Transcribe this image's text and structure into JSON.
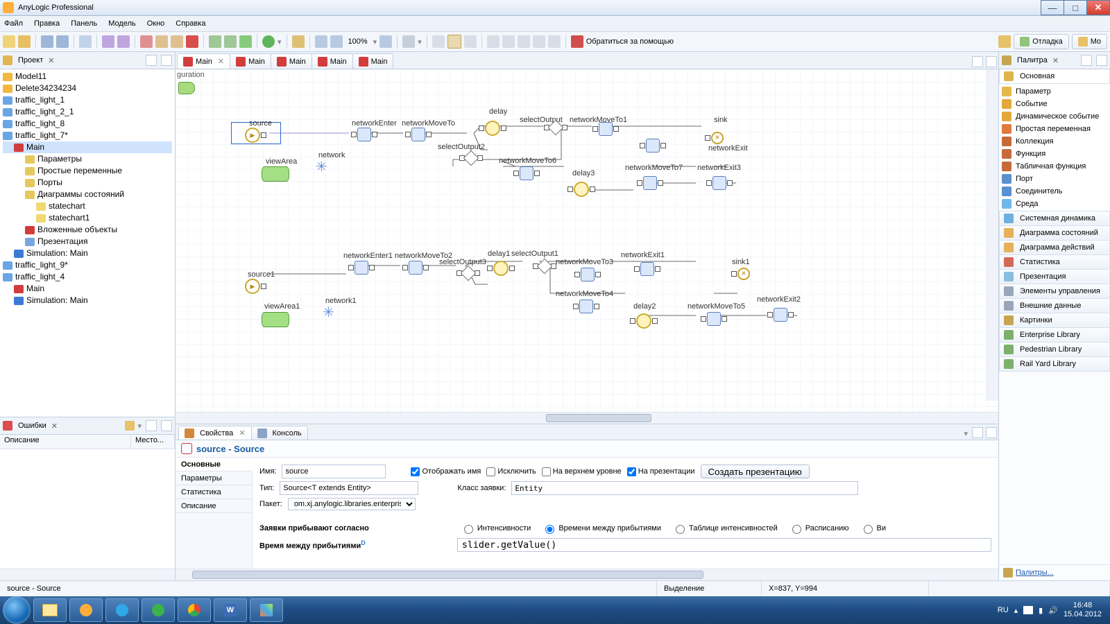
{
  "window": {
    "title": "AnyLogic Professional"
  },
  "menu": [
    "Файл",
    "Правка",
    "Панель",
    "Модель",
    "Окно",
    "Справка"
  ],
  "toolbar": {
    "zoom": "100%",
    "help": "Обратиться за помощью",
    "debug": "Отладка",
    "mo": "Mo"
  },
  "panels": {
    "project": "Проект",
    "errors": "Ошибки",
    "palette": "Палитра"
  },
  "tree": [
    {
      "t": "Model11",
      "ind": 0,
      "c": "#f3b83f"
    },
    {
      "t": "Delete34234234",
      "ind": 0,
      "c": "#f3b83f"
    },
    {
      "t": "traffic_light_1",
      "ind": 0,
      "c": "#6aa5e6"
    },
    {
      "t": "traffic_light_2_1",
      "ind": 0,
      "c": "#6aa5e6"
    },
    {
      "t": "traffic_light_8",
      "ind": 0,
      "c": "#6aa5e6"
    },
    {
      "t": "traffic_light_7*",
      "ind": 0,
      "c": "#6aa5e6"
    },
    {
      "t": "Main",
      "ind": 1,
      "c": "#d23c3c",
      "sel": true
    },
    {
      "t": "Параметры",
      "ind": 2,
      "c": "#e6c85d"
    },
    {
      "t": "Простые переменные",
      "ind": 2,
      "c": "#e6c85d"
    },
    {
      "t": "Порты",
      "ind": 2,
      "c": "#e6c85d"
    },
    {
      "t": "Диаграммы состояний",
      "ind": 2,
      "c": "#e6c85d"
    },
    {
      "t": "statechart",
      "ind": 3,
      "c": "#f0d873"
    },
    {
      "t": "statechart1",
      "ind": 3,
      "c": "#f0d873"
    },
    {
      "t": "Вложенные объекты",
      "ind": 2,
      "c": "#d23c3c"
    },
    {
      "t": "Презентация",
      "ind": 2,
      "c": "#7aa6e0"
    },
    {
      "t": "Simulation: Main",
      "ind": 1,
      "c": "#3a7bd5"
    },
    {
      "t": "traffic_light_9*",
      "ind": 0,
      "c": "#6aa5e6"
    },
    {
      "t": "traffic_light_4",
      "ind": 0,
      "c": "#6aa5e6"
    },
    {
      "t": "Main",
      "ind": 1,
      "c": "#d23c3c"
    },
    {
      "t": "Simulation: Main",
      "ind": 1,
      "c": "#3a7bd5"
    }
  ],
  "err": {
    "col1": "Описание",
    "col2": "Место..."
  },
  "editor": {
    "tabs": [
      "Main",
      "Main",
      "Main",
      "Main",
      "Main"
    ],
    "corner": "guration"
  },
  "nodes": {
    "source": "source",
    "networkEnter": "networkEnter",
    "networkMoveTo": "networkMoveTo",
    "delay": "delay",
    "selectOutput": "selectOutput",
    "networkMoveTo1": "networkMoveTo1",
    "sink": "sink",
    "networkExit": "networkExit",
    "selectOutput2": "selectOutput2",
    "viewArea": "viewArea",
    "network": "network",
    "networkMoveTo6": "networkMoveTo6",
    "delay3": "delay3",
    "networkMoveTo7": "networkMoveTo7",
    "networkExit3": "networkExit3",
    "source1": "source1",
    "networkEnter1": "networkEnter1",
    "networkMoveTo2": "networkMoveTo2",
    "selectOutput3": "selectOutput3",
    "delay1": "delay1",
    "selectOutput1": "selectOutput1",
    "networkMoveTo3": "networkMoveTo3",
    "networkExit1": "networkExit1",
    "sink1": "sink1",
    "viewArea1": "viewArea1",
    "network1": "network1",
    "networkMoveTo4": "networkMoveTo4",
    "delay2": "delay2",
    "networkMoveTo5": "networkMoveTo5",
    "networkExit2": "networkExit2"
  },
  "props": {
    "tabProperties": "Свойства",
    "tabConsole": "Консоль",
    "title": "source - Source",
    "side": [
      "Основные",
      "Параметры",
      "Статистика",
      "Описание"
    ],
    "lblName": "Имя:",
    "valName": "source",
    "cbShowName": "Отображать имя",
    "cbExclude": "Исключить",
    "cbTop": "На верхнем уровне",
    "cbPresent": "На презентации",
    "btnCreate": "Создать презентацию",
    "lblType": "Тип:",
    "valType": "Source<T extends Entity>",
    "lblClass": "Класс заявки:",
    "valClass": "Entity",
    "lblPkg": "Пакет:",
    "valPkg": "om.xj.anylogic.libraries.enterprise",
    "lblArrive": "Заявки прибывают согласно",
    "rIntensity": "Интенсивности",
    "rTime": "Времени между прибытиями",
    "rTable": "Таблице интенсивностей",
    "rSched": "Расписанию",
    "rMore": "Ви",
    "lblInter": "Время между прибытиями",
    "sup": "D",
    "valCode": "slider.getValue()"
  },
  "palette": {
    "section": "Основная",
    "items": [
      {
        "t": "Параметр",
        "c": "#e4b84a"
      },
      {
        "t": "Событие",
        "c": "#e4a83a"
      },
      {
        "t": "Динамическое событие",
        "c": "#e4a83a"
      },
      {
        "t": "Простая переменная",
        "c": "#e07a3d"
      },
      {
        "t": "Коллекция",
        "c": "#c66a3a"
      },
      {
        "t": "Функция",
        "c": "#c66a3a"
      },
      {
        "t": "Табличная функция",
        "c": "#c66a3a"
      },
      {
        "t": "Порт",
        "c": "#5a8fd0"
      },
      {
        "t": "Соединитель",
        "c": "#5a8fd0"
      },
      {
        "t": "Среда",
        "c": "#6fb9e8"
      }
    ],
    "sections": [
      "Системная динамика",
      "Диаграмма состояний",
      "Диаграмма действий",
      "Статистика",
      "Презентация",
      "Элементы управления",
      "Внешние данные",
      "Картинки",
      "Enterprise Library",
      "Pedestrian Library",
      "Rail Yard Library"
    ],
    "link": "Палитры..."
  },
  "status": {
    "left": "source - Source",
    "mode": "Выделение",
    "coords": "X=837, Y=994"
  },
  "taskbar": {
    "lang": "RU",
    "time": "16:48",
    "date": "15.04.2012"
  }
}
